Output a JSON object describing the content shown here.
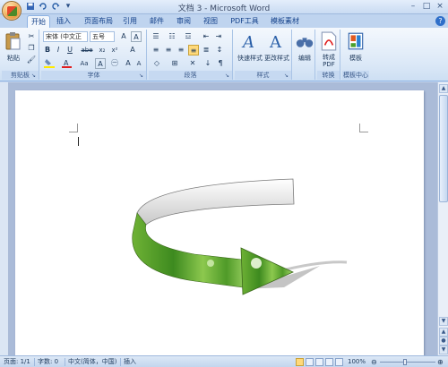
{
  "window": {
    "title": "文档 3 - Microsoft Word",
    "controls": [
      "–",
      "□",
      "×"
    ]
  },
  "qat": [
    "save",
    "undo",
    "redo",
    "more"
  ],
  "tabs": [
    "开始",
    "插入",
    "页面布局",
    "引用",
    "邮件",
    "审阅",
    "视图",
    "PDF工具",
    "模板素材"
  ],
  "active_tab": "开始",
  "ribbon": {
    "clipboard": {
      "label": "剪贴板",
      "paste": "粘贴"
    },
    "font": {
      "label": "字体",
      "font_name": "宋体 (中文正",
      "font_size": "五号"
    },
    "paragraph": {
      "label": "段落"
    },
    "styles": {
      "label": "样式",
      "quick_styles": "快速样式",
      "change_styles": "更改样式"
    },
    "edit": {
      "label": "编辑"
    },
    "convert": {
      "label": "转换",
      "to_pdf": "转成\nPDF"
    },
    "template": {
      "label": "模板中心",
      "template_btn": "模板"
    }
  },
  "status": {
    "page": "页面: 1/1",
    "words": "字数: 0",
    "language": "中文(简体，中国)",
    "mode": "插入",
    "zoom": "100%"
  },
  "colors": {
    "ribbon_bg": "#dbe8f7",
    "accent": "#15428b",
    "arrow_green": "#5aa02c",
    "arrow_top": "#d8d8d8"
  }
}
